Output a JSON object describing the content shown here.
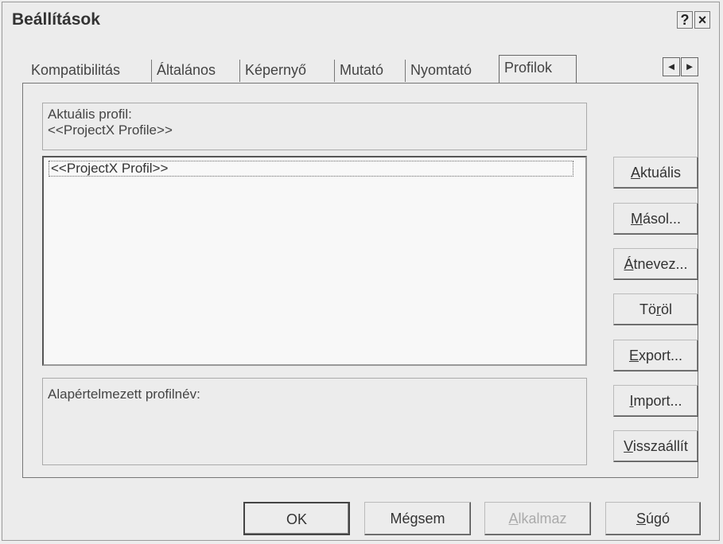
{
  "window": {
    "title": "Beállítások",
    "help_label": "?",
    "close_label": "×"
  },
  "tabs": [
    {
      "label": "Kompatibilitás",
      "active": false
    },
    {
      "label": "Általános",
      "active": false
    },
    {
      "label": "Képernyő",
      "active": false
    },
    {
      "label": "Mutató",
      "active": false
    },
    {
      "label": "Nyomtató",
      "active": false
    },
    {
      "label": "Profilok",
      "active": true
    }
  ],
  "tab_scroll": {
    "left": "◄",
    "right": "►"
  },
  "current_profile": {
    "label": "Aktuális profil:",
    "value": "<<ProjectX Profile>>"
  },
  "profile_list": {
    "items": [
      "<<ProjectX Profil>>"
    ]
  },
  "default_profile": {
    "label": "Alapértelmezett profilnév:"
  },
  "side_buttons": [
    {
      "pre": "",
      "key": "A",
      "post": "ktuális"
    },
    {
      "pre": "",
      "key": "M",
      "post": "ásol..."
    },
    {
      "pre": "",
      "key": "Á",
      "post": "tnevez..."
    },
    {
      "pre": "Tö",
      "key": "r",
      "post": "öl"
    },
    {
      "pre": "",
      "key": "E",
      "post": "xport..."
    },
    {
      "pre": "",
      "key": "I",
      "post": "mport..."
    },
    {
      "pre": "",
      "key": "V",
      "post": "isszaállít"
    }
  ],
  "bottom_buttons": {
    "ok": "OK",
    "cancel": "Mégsem",
    "apply_key": "A",
    "apply_rest": "lkalmaz",
    "help_key": "S",
    "help_rest": "úgó"
  }
}
